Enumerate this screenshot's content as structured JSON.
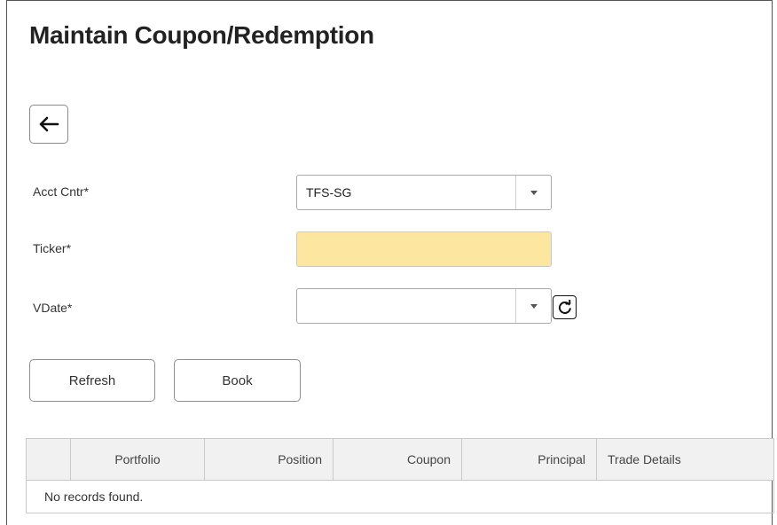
{
  "page": {
    "title": "Maintain Coupon/Redemption"
  },
  "icons": {
    "back": "arrow-left-icon",
    "select_caret": "caret-down-icon",
    "reload": "refresh-icon"
  },
  "colors": {
    "required_field_bg": "#fde7a0",
    "table_header_bg": "#f1f1f1",
    "border": "#a9a9a9"
  },
  "form": {
    "acct_cntr": {
      "label": "Acct Cntr*",
      "value": "TFS-SG"
    },
    "ticker": {
      "label": "Ticker*",
      "value": ""
    },
    "vdate": {
      "label": "VDate*",
      "value": ""
    }
  },
  "actions": {
    "refresh_label": "Refresh",
    "book_label": "Book"
  },
  "table": {
    "columns": [
      "",
      "Portfolio",
      "Position",
      "Coupon",
      "Principal",
      "Trade Details"
    ],
    "empty_message": "No records found."
  }
}
